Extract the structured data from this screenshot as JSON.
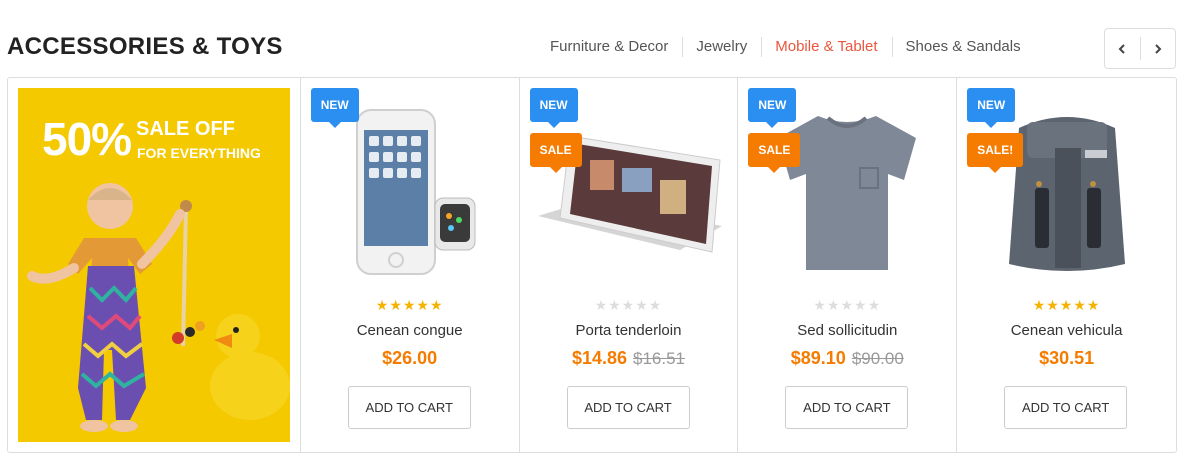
{
  "section": {
    "title": "ACCESSORIES & TOYS"
  },
  "tabs": [
    {
      "label": "Furniture & Decor"
    },
    {
      "label": "Jewelry"
    },
    {
      "label": "Mobile & Tablet"
    },
    {
      "label": "Shoes & Sandals"
    }
  ],
  "nav": {
    "prev_icon": "chevron-left-icon",
    "next_icon": "chevron-right-icon"
  },
  "banner": {
    "percent": "50%",
    "sale": "SALE OFF",
    "sub": "FOR EVERYTHING"
  },
  "products": [
    {
      "name": "Cenean congue",
      "price": "$26.00",
      "old_price": "",
      "badges": [
        "NEW"
      ],
      "rating": 5,
      "cart": "ADD TO CART",
      "image": "phone-watch"
    },
    {
      "name": "Porta tenderloin",
      "price": "$14.86",
      "old_price": "$16.51",
      "badges": [
        "NEW",
        "SALE"
      ],
      "rating": 0,
      "cart": "ADD TO CART",
      "image": "tablet"
    },
    {
      "name": "Sed sollicitudin",
      "price": "$89.10",
      "old_price": "$90.00",
      "badges": [
        "NEW",
        "SALE"
      ],
      "rating": 0,
      "cart": "ADD TO CART",
      "image": "tshirt"
    },
    {
      "name": "Cenean vehicula",
      "price": "$30.51",
      "old_price": "",
      "badges": [
        "NEW",
        "SALE!"
      ],
      "rating": 5,
      "cart": "ADD TO CART",
      "image": "backpack"
    }
  ],
  "colors": {
    "accent": "#e9573f",
    "price": "#f57c00",
    "new_badge": "#2a8ff0",
    "sale_badge": "#f57c00",
    "star": "#f5b301"
  }
}
